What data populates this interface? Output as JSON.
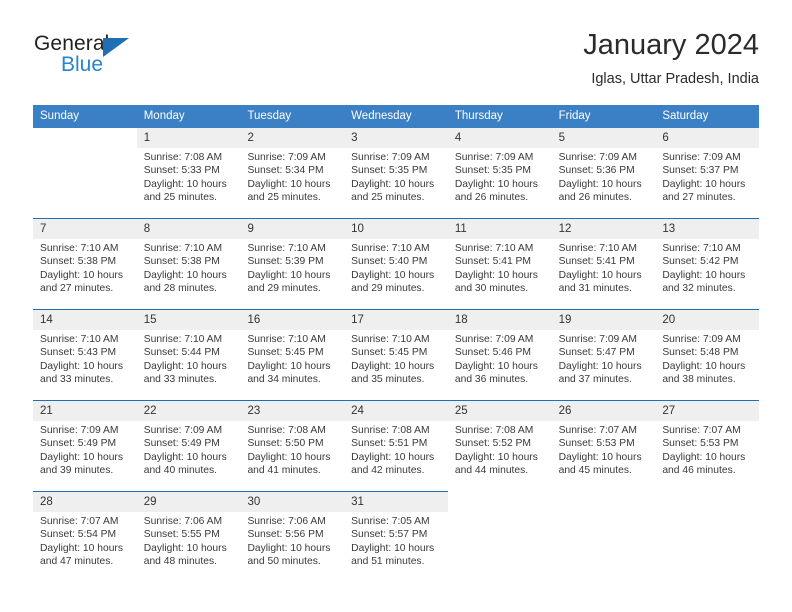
{
  "brand": {
    "name_top": "General",
    "name_bottom": "Blue",
    "triangle_color": "#1f6fb5",
    "blue_color": "#2585d3"
  },
  "header": {
    "title": "January 2024",
    "subtitle": "Iglas, Uttar Pradesh, India"
  },
  "theme": {
    "header_bg": "#3b7fc4",
    "daynum_bg": "#efefef",
    "rule_color": "#1f6fb5",
    "text_color": "#3a3a3a"
  },
  "weekdays": [
    "Sunday",
    "Monday",
    "Tuesday",
    "Wednesday",
    "Thursday",
    "Friday",
    "Saturday"
  ],
  "weeks": [
    {
      "days": [
        {
          "num": "",
          "sunrise": "",
          "sunset": "",
          "daylight_1": "",
          "daylight_2": ""
        },
        {
          "num": "1",
          "sunrise": "Sunrise: 7:08 AM",
          "sunset": "Sunset: 5:33 PM",
          "daylight_1": "Daylight: 10 hours",
          "daylight_2": "and 25 minutes."
        },
        {
          "num": "2",
          "sunrise": "Sunrise: 7:09 AM",
          "sunset": "Sunset: 5:34 PM",
          "daylight_1": "Daylight: 10 hours",
          "daylight_2": "and 25 minutes."
        },
        {
          "num": "3",
          "sunrise": "Sunrise: 7:09 AM",
          "sunset": "Sunset: 5:35 PM",
          "daylight_1": "Daylight: 10 hours",
          "daylight_2": "and 25 minutes."
        },
        {
          "num": "4",
          "sunrise": "Sunrise: 7:09 AM",
          "sunset": "Sunset: 5:35 PM",
          "daylight_1": "Daylight: 10 hours",
          "daylight_2": "and 26 minutes."
        },
        {
          "num": "5",
          "sunrise": "Sunrise: 7:09 AM",
          "sunset": "Sunset: 5:36 PM",
          "daylight_1": "Daylight: 10 hours",
          "daylight_2": "and 26 minutes."
        },
        {
          "num": "6",
          "sunrise": "Sunrise: 7:09 AM",
          "sunset": "Sunset: 5:37 PM",
          "daylight_1": "Daylight: 10 hours",
          "daylight_2": "and 27 minutes."
        }
      ]
    },
    {
      "days": [
        {
          "num": "7",
          "sunrise": "Sunrise: 7:10 AM",
          "sunset": "Sunset: 5:38 PM",
          "daylight_1": "Daylight: 10 hours",
          "daylight_2": "and 27 minutes."
        },
        {
          "num": "8",
          "sunrise": "Sunrise: 7:10 AM",
          "sunset": "Sunset: 5:38 PM",
          "daylight_1": "Daylight: 10 hours",
          "daylight_2": "and 28 minutes."
        },
        {
          "num": "9",
          "sunrise": "Sunrise: 7:10 AM",
          "sunset": "Sunset: 5:39 PM",
          "daylight_1": "Daylight: 10 hours",
          "daylight_2": "and 29 minutes."
        },
        {
          "num": "10",
          "sunrise": "Sunrise: 7:10 AM",
          "sunset": "Sunset: 5:40 PM",
          "daylight_1": "Daylight: 10 hours",
          "daylight_2": "and 29 minutes."
        },
        {
          "num": "11",
          "sunrise": "Sunrise: 7:10 AM",
          "sunset": "Sunset: 5:41 PM",
          "daylight_1": "Daylight: 10 hours",
          "daylight_2": "and 30 minutes."
        },
        {
          "num": "12",
          "sunrise": "Sunrise: 7:10 AM",
          "sunset": "Sunset: 5:41 PM",
          "daylight_1": "Daylight: 10 hours",
          "daylight_2": "and 31 minutes."
        },
        {
          "num": "13",
          "sunrise": "Sunrise: 7:10 AM",
          "sunset": "Sunset: 5:42 PM",
          "daylight_1": "Daylight: 10 hours",
          "daylight_2": "and 32 minutes."
        }
      ]
    },
    {
      "days": [
        {
          "num": "14",
          "sunrise": "Sunrise: 7:10 AM",
          "sunset": "Sunset: 5:43 PM",
          "daylight_1": "Daylight: 10 hours",
          "daylight_2": "and 33 minutes."
        },
        {
          "num": "15",
          "sunrise": "Sunrise: 7:10 AM",
          "sunset": "Sunset: 5:44 PM",
          "daylight_1": "Daylight: 10 hours",
          "daylight_2": "and 33 minutes."
        },
        {
          "num": "16",
          "sunrise": "Sunrise: 7:10 AM",
          "sunset": "Sunset: 5:45 PM",
          "daylight_1": "Daylight: 10 hours",
          "daylight_2": "and 34 minutes."
        },
        {
          "num": "17",
          "sunrise": "Sunrise: 7:10 AM",
          "sunset": "Sunset: 5:45 PM",
          "daylight_1": "Daylight: 10 hours",
          "daylight_2": "and 35 minutes."
        },
        {
          "num": "18",
          "sunrise": "Sunrise: 7:09 AM",
          "sunset": "Sunset: 5:46 PM",
          "daylight_1": "Daylight: 10 hours",
          "daylight_2": "and 36 minutes."
        },
        {
          "num": "19",
          "sunrise": "Sunrise: 7:09 AM",
          "sunset": "Sunset: 5:47 PM",
          "daylight_1": "Daylight: 10 hours",
          "daylight_2": "and 37 minutes."
        },
        {
          "num": "20",
          "sunrise": "Sunrise: 7:09 AM",
          "sunset": "Sunset: 5:48 PM",
          "daylight_1": "Daylight: 10 hours",
          "daylight_2": "and 38 minutes."
        }
      ]
    },
    {
      "days": [
        {
          "num": "21",
          "sunrise": "Sunrise: 7:09 AM",
          "sunset": "Sunset: 5:49 PM",
          "daylight_1": "Daylight: 10 hours",
          "daylight_2": "and 39 minutes."
        },
        {
          "num": "22",
          "sunrise": "Sunrise: 7:09 AM",
          "sunset": "Sunset: 5:49 PM",
          "daylight_1": "Daylight: 10 hours",
          "daylight_2": "and 40 minutes."
        },
        {
          "num": "23",
          "sunrise": "Sunrise: 7:08 AM",
          "sunset": "Sunset: 5:50 PM",
          "daylight_1": "Daylight: 10 hours",
          "daylight_2": "and 41 minutes."
        },
        {
          "num": "24",
          "sunrise": "Sunrise: 7:08 AM",
          "sunset": "Sunset: 5:51 PM",
          "daylight_1": "Daylight: 10 hours",
          "daylight_2": "and 42 minutes."
        },
        {
          "num": "25",
          "sunrise": "Sunrise: 7:08 AM",
          "sunset": "Sunset: 5:52 PM",
          "daylight_1": "Daylight: 10 hours",
          "daylight_2": "and 44 minutes."
        },
        {
          "num": "26",
          "sunrise": "Sunrise: 7:07 AM",
          "sunset": "Sunset: 5:53 PM",
          "daylight_1": "Daylight: 10 hours",
          "daylight_2": "and 45 minutes."
        },
        {
          "num": "27",
          "sunrise": "Sunrise: 7:07 AM",
          "sunset": "Sunset: 5:53 PM",
          "daylight_1": "Daylight: 10 hours",
          "daylight_2": "and 46 minutes."
        }
      ]
    },
    {
      "days": [
        {
          "num": "28",
          "sunrise": "Sunrise: 7:07 AM",
          "sunset": "Sunset: 5:54 PM",
          "daylight_1": "Daylight: 10 hours",
          "daylight_2": "and 47 minutes."
        },
        {
          "num": "29",
          "sunrise": "Sunrise: 7:06 AM",
          "sunset": "Sunset: 5:55 PM",
          "daylight_1": "Daylight: 10 hours",
          "daylight_2": "and 48 minutes."
        },
        {
          "num": "30",
          "sunrise": "Sunrise: 7:06 AM",
          "sunset": "Sunset: 5:56 PM",
          "daylight_1": "Daylight: 10 hours",
          "daylight_2": "and 50 minutes."
        },
        {
          "num": "31",
          "sunrise": "Sunrise: 7:05 AM",
          "sunset": "Sunset: 5:57 PM",
          "daylight_1": "Daylight: 10 hours",
          "daylight_2": "and 51 minutes."
        },
        {
          "num": "",
          "sunrise": "",
          "sunset": "",
          "daylight_1": "",
          "daylight_2": ""
        },
        {
          "num": "",
          "sunrise": "",
          "sunset": "",
          "daylight_1": "",
          "daylight_2": ""
        },
        {
          "num": "",
          "sunrise": "",
          "sunset": "",
          "daylight_1": "",
          "daylight_2": ""
        }
      ]
    }
  ]
}
